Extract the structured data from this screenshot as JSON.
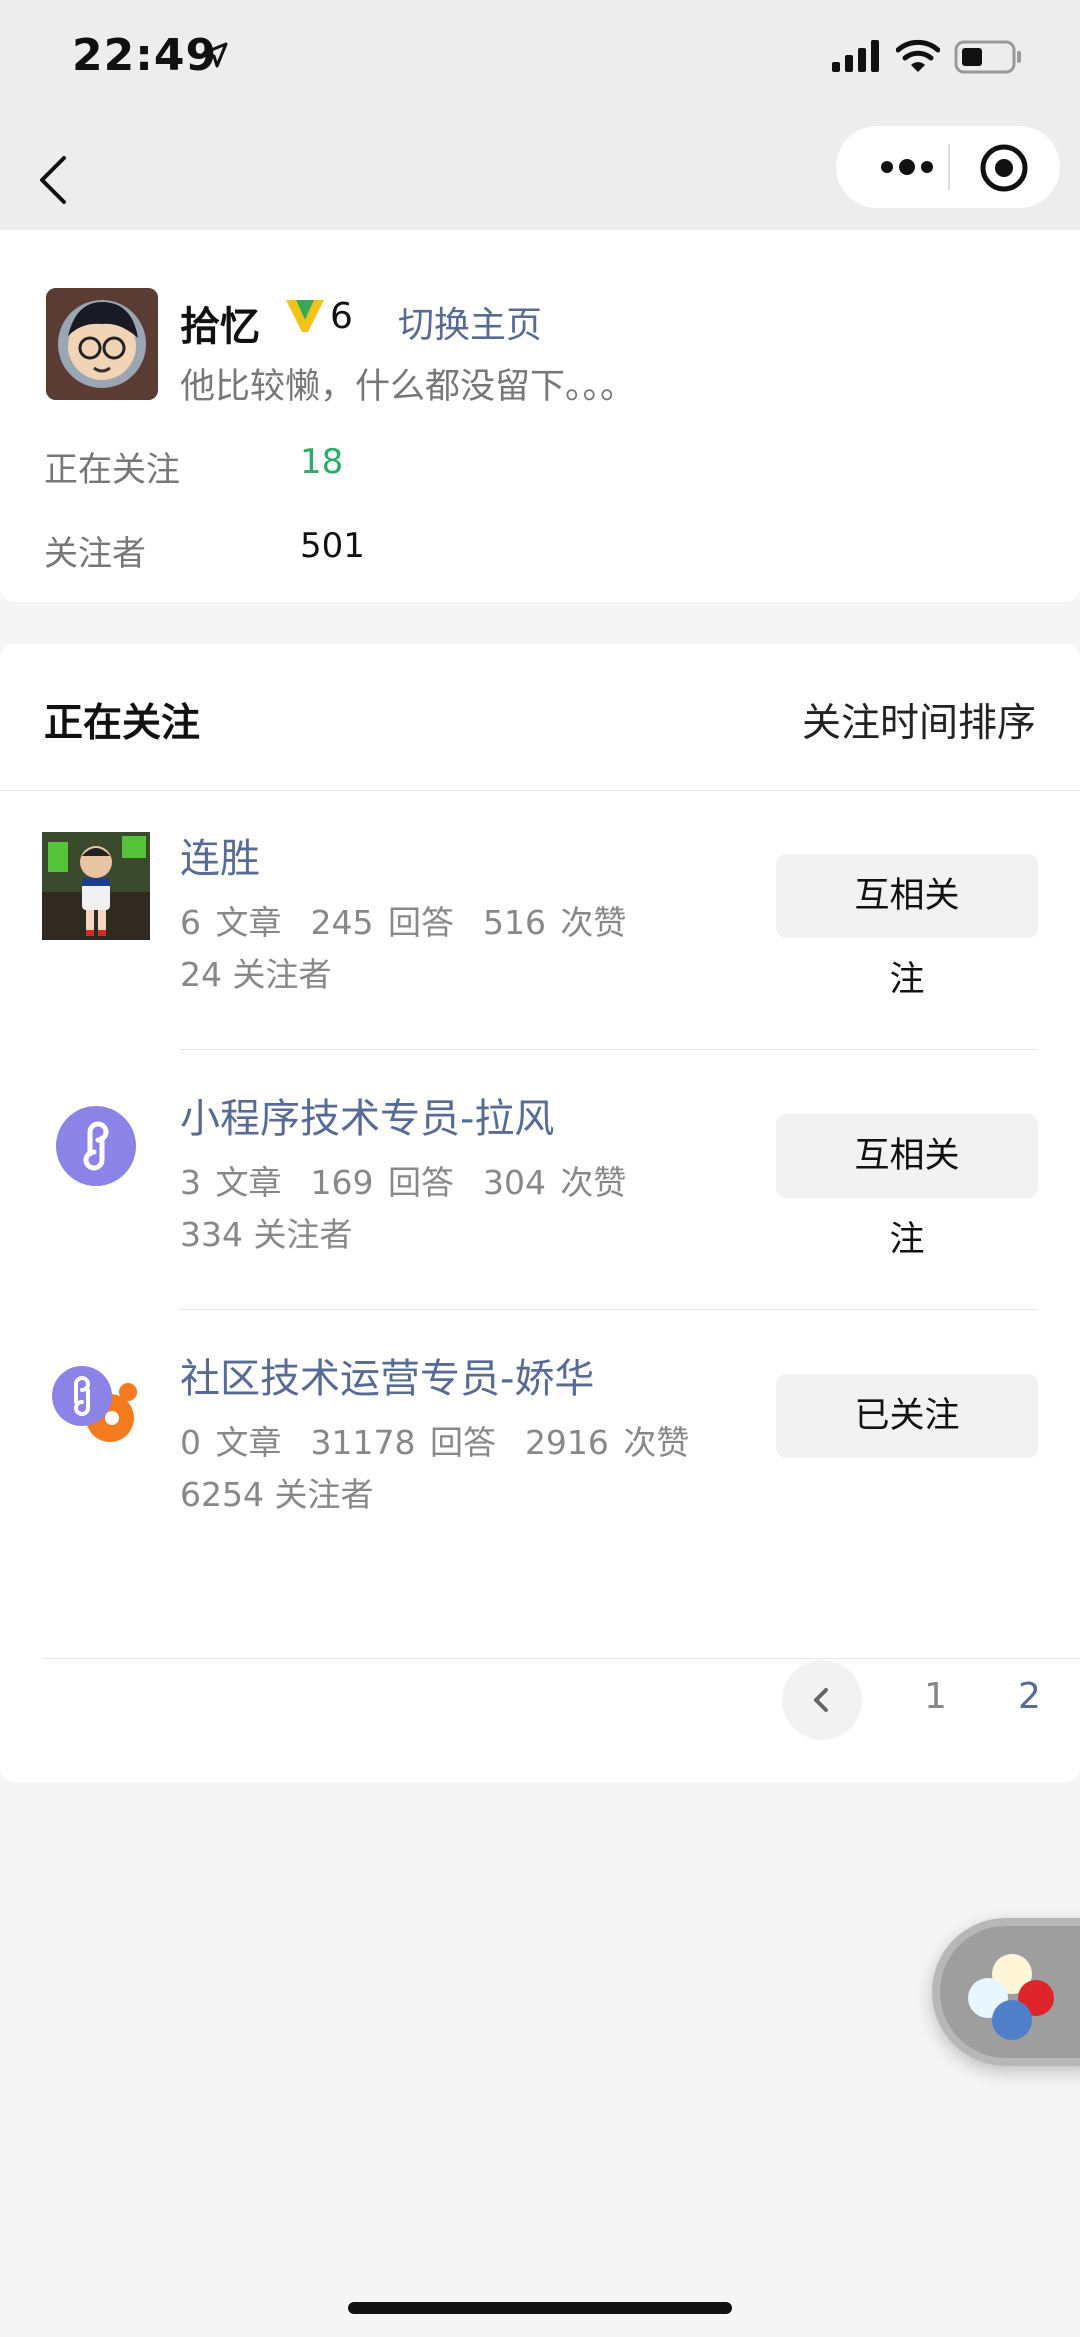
{
  "status_bar": {
    "time": "22:49"
  },
  "profile": {
    "username": "拾忆",
    "level": "6",
    "switch_label": "切换主页",
    "bio": "他比较懒，什么都没留下。。。",
    "stats": [
      {
        "label": "正在关注",
        "value": "18"
      },
      {
        "label": "关注者",
        "value": "501"
      }
    ]
  },
  "following_section": {
    "title": "正在关注",
    "sort_label": "关注时间排序",
    "items": [
      {
        "name": "连胜",
        "articles": "6 文章",
        "answers": "245 回答",
        "likes": "516 次赞",
        "followers": "24 关注者",
        "button_head": "互相关",
        "button_tail": "注"
      },
      {
        "name": "小程序技术专员-拉风",
        "articles": "3 文章",
        "answers": "169 回答",
        "likes": "304 次赞",
        "followers": "334 关注者",
        "button_head": "互相关",
        "button_tail": "注"
      },
      {
        "name": "社区技术运营专员-娇华",
        "articles": "0 文章",
        "answers": "31178 回答",
        "likes": "2916 次赞",
        "followers": "6254 关注者",
        "button_head": "已关注",
        "button_tail": ""
      }
    ]
  },
  "pagination": {
    "pages": [
      "1",
      "2"
    ],
    "current": "2"
  },
  "colors": {
    "link": "#576b95",
    "accent_green": "#2aae67",
    "miniprogram": "#8c83e6",
    "orange": "#f47a20"
  },
  "icons": [
    "location-arrow-icon",
    "signal-icon",
    "wifi-icon",
    "battery-icon",
    "back-chevron-icon",
    "more-dots-icon",
    "close-target-icon",
    "v-level-badge-icon",
    "miniprogram-link-icon",
    "chevron-left-icon"
  ]
}
